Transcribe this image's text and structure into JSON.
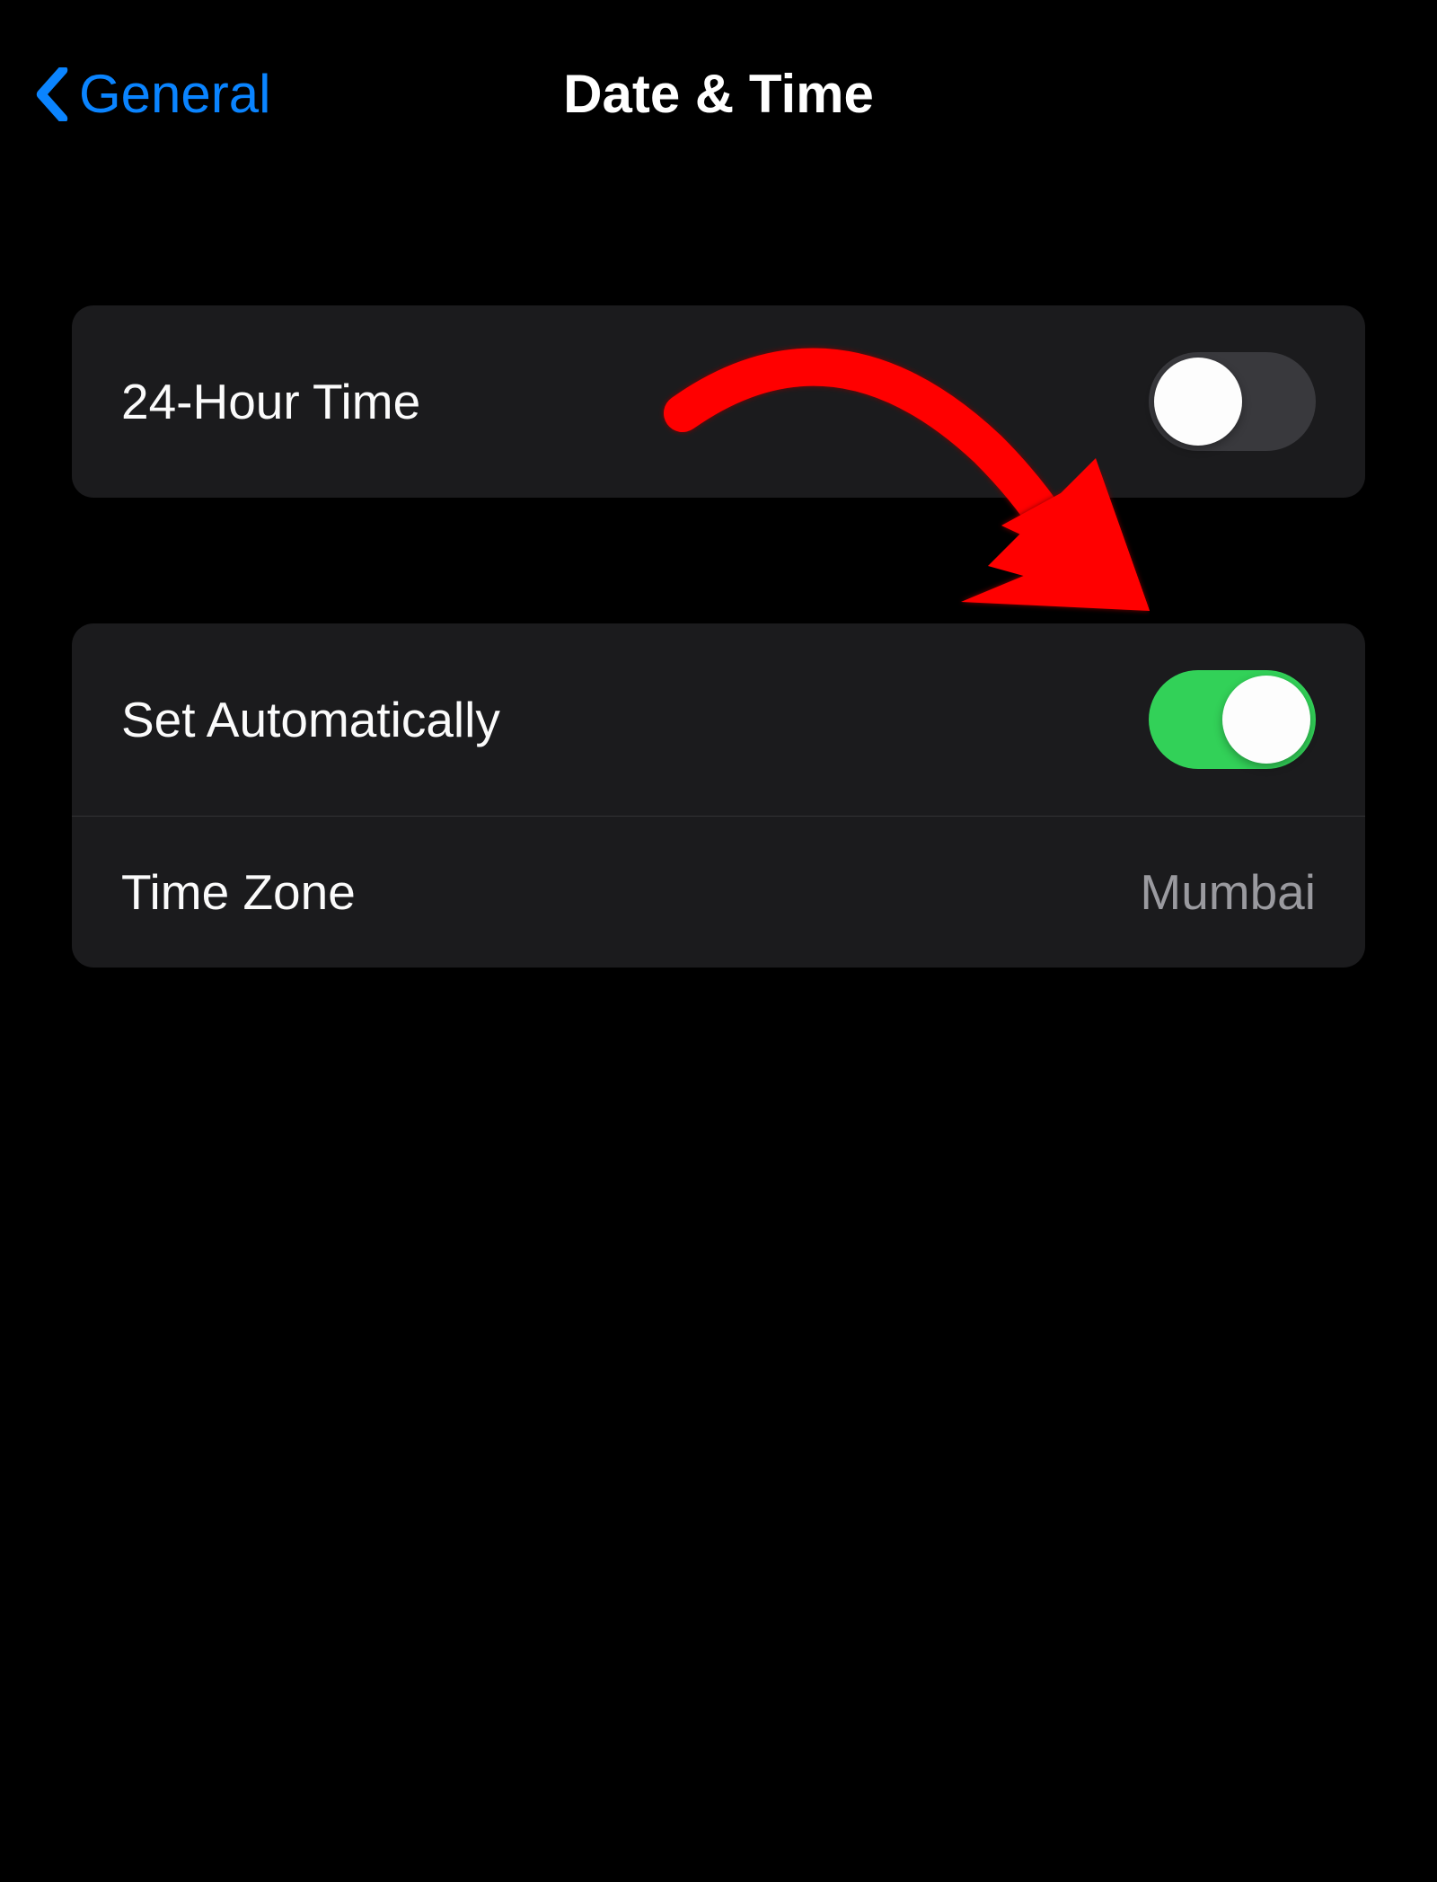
{
  "header": {
    "back_label": "General",
    "title": "Date & Time"
  },
  "rows": {
    "twenty_four_hour": {
      "label": "24-Hour Time",
      "enabled": false
    },
    "set_automatically": {
      "label": "Set Automatically",
      "enabled": true
    },
    "time_zone": {
      "label": "Time Zone",
      "value": "Mumbai"
    }
  },
  "annotation": {
    "type": "red-curved-arrow",
    "points_to": "set-automatically-toggle",
    "color": "#ff0000"
  }
}
